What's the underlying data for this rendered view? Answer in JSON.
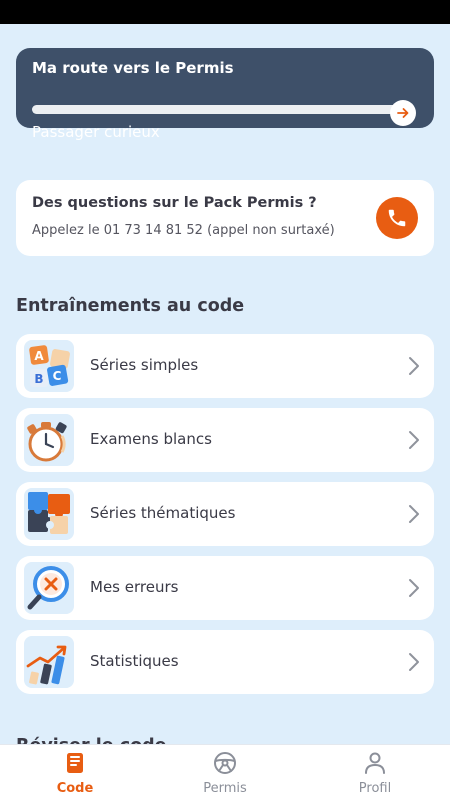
{
  "progress_card": {
    "title": "Ma route vers le Permis",
    "level": "Passager curieux",
    "progress": 0.0,
    "accent": "#f05a14",
    "background": "#3e5069"
  },
  "contact_card": {
    "title": "Des questions sur le Pack Permis ?",
    "subtitle": "Appelez le 01 73 14 81 52 (appel non surtaxé)",
    "button_color": "#e85d12"
  },
  "training": {
    "title": "Entraînements au code",
    "items": [
      {
        "label": "Séries simples",
        "icon": "abc-blocks-icon"
      },
      {
        "label": "Examens blancs",
        "icon": "stopwatch-icon"
      },
      {
        "label": "Séries thématiques",
        "icon": "puzzle-icon"
      },
      {
        "label": "Mes erreurs",
        "icon": "magnifier-error-icon"
      },
      {
        "label": "Statistiques",
        "icon": "stats-chart-icon"
      }
    ]
  },
  "next_section": {
    "title": "Réviser le code"
  },
  "bottom_nav": {
    "items": [
      {
        "label": "Code",
        "icon": "book-icon",
        "active": true
      },
      {
        "label": "Permis",
        "icon": "steering-wheel-icon",
        "active": false
      },
      {
        "label": "Profil",
        "icon": "user-icon",
        "active": false
      }
    ],
    "active_color": "#e85d12",
    "inactive_color": "#8b8f99"
  }
}
